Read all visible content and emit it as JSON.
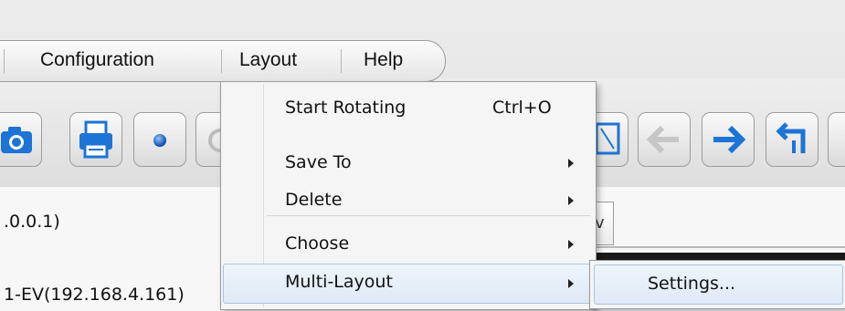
{
  "menubar": {
    "items": [
      {
        "label": "Configuration"
      },
      {
        "label": "Layout"
      },
      {
        "label": "Help"
      }
    ]
  },
  "layout_menu": {
    "items": [
      {
        "label": "Start Rotating",
        "shortcut": "Ctrl+O"
      },
      {
        "label": "Save To",
        "has_submenu": true
      },
      {
        "label": "Delete",
        "has_submenu": true
      },
      {
        "label": "Choose",
        "has_submenu": true
      },
      {
        "label": "Multi-Layout",
        "has_submenu": true,
        "highlighted": true
      }
    ]
  },
  "submenu": {
    "items": [
      {
        "label": "Settings..."
      }
    ]
  },
  "device_list": {
    "items": [
      {
        "label": ".0.0.1)"
      },
      {
        "label": "1-EV(192.168.4.161)"
      }
    ]
  },
  "side_tab": {
    "label": "v"
  },
  "toolbar": {
    "icons": [
      "camera-icon",
      "print-icon",
      "record-icon",
      "fullscreen-icon",
      "back-arrow-icon",
      "forward-arrow-icon",
      "layout-return-icon"
    ]
  },
  "colors": {
    "highlight": "#dfe9f6",
    "highlight_border": "#a9c3e0",
    "icon_blue": "#1b74d6",
    "menu_bg": "#f5f5f5"
  }
}
